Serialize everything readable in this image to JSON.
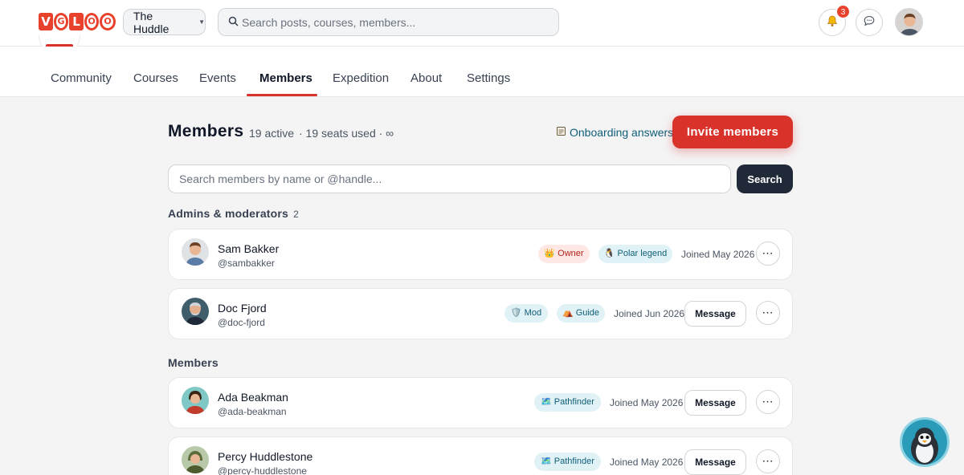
{
  "topbar": {
    "logo_letters": [
      "V",
      "G",
      "L",
      "O",
      "O"
    ],
    "space_name": "The Huddle",
    "search_placeholder": "Search posts, courses, members...",
    "notification_count": "3"
  },
  "nav": {
    "tabs": [
      {
        "label": "Community"
      },
      {
        "label": "Courses"
      },
      {
        "label": "Events"
      },
      {
        "label": "Members"
      },
      {
        "label": "Expedition"
      },
      {
        "label": "About"
      },
      {
        "label": "Settings"
      }
    ],
    "active_tab": "Members"
  },
  "header": {
    "title": "Members",
    "active_count": "19 active",
    "seats": "· 19 seats used · ∞",
    "onboarding_label": "Onboarding answers",
    "invite_label": "Invite members"
  },
  "member_search": {
    "placeholder": "Search members by name or @handle...",
    "button_label": "Search"
  },
  "sections": {
    "admins": {
      "label": "Admins & moderators",
      "count": "2"
    },
    "members": {
      "label": "Members"
    }
  },
  "admins": [
    {
      "name": "Sam Bakker",
      "handle": "@sambakker",
      "badges": [
        "👑 Owner",
        "🐧 Polar legend"
      ],
      "joined": "Joined May 2026"
    },
    {
      "name": "Doc Fjord",
      "handle": "@doc-fjord",
      "badges": [
        "🛡️ Mod",
        "⛺ Guide"
      ],
      "joined": "Joined Jun 2026",
      "message_label": "Message"
    }
  ],
  "members": [
    {
      "name": "Ada Beakman",
      "handle": "@ada-beakman",
      "badge": "🗺️ Pathfinder",
      "joined": "Joined May 2026",
      "message_label": "Message"
    },
    {
      "name": "Percy Huddlestone",
      "handle": "@percy-huddlestone",
      "badge": "🗺️ Pathfinder",
      "joined": "Joined May 2026",
      "message_label": "Message"
    }
  ],
  "colors": {
    "brand": "#d8322a",
    "link": "#0f5e78",
    "dark_button": "#1f2937"
  }
}
